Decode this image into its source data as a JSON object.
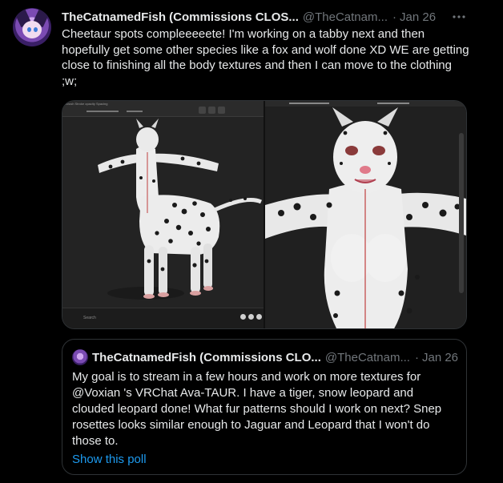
{
  "post": {
    "author_name": "TheCatnamedFish (Commissions CLOS...",
    "handle": "@TheCatnam...",
    "separator": "·",
    "date": "Jan 26",
    "more_icon": "more-horizontal-icon",
    "text": "Cheetaur spots compleeeeete! I'm working on a tabby next and then hopefully get some other species like a fox and wolf done XD WE are getting close to finishing all the body textures and then I can move to the clothing ;w;"
  },
  "media": {
    "left_toolbar_text": "Brush   Stroke opacity   Spacing",
    "left_bottom_search": "Search",
    "left_description": "3D editor viewport with white spotted cheetaur model in T-pose",
    "right_description": "Close-up of white spotted cheetaur model face and torso"
  },
  "quote": {
    "author_name": "TheCatnamedFish (Commissions CLO...",
    "handle": "@TheCatnam...",
    "separator": "·",
    "date": "Jan 26",
    "text": "My goal is to stream in a few hours and work on more textures for @Voxian 's VRChat Ava-TAUR. I have a tiger, snow leopard and clouded leopard done! What fur patterns should I work on next? Snep rosettes looks similar enough to Jaguar and Leopard that I won't do those to.",
    "poll_link": "Show this poll"
  },
  "colors": {
    "background": "#000000",
    "text": "#e7e9ea",
    "muted": "#71767b",
    "border": "#2f3336",
    "link": "#1d9bf0"
  }
}
